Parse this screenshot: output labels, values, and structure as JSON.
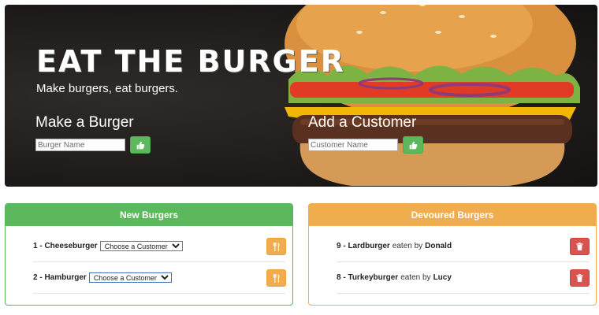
{
  "hero": {
    "title": "EAT THE BURGER",
    "tagline": "Make burgers, eat burgers.",
    "make_burger": {
      "heading": "Make a Burger",
      "placeholder": "Burger Name",
      "button_icon": "thumbs-up-icon"
    },
    "add_customer": {
      "heading": "Add a Customer",
      "placeholder": "Customer Name",
      "button_icon": "thumbs-up-icon"
    }
  },
  "new_burgers": {
    "header": "New Burgers",
    "select_default": "Choose a Customer",
    "button_icon": "utensils-icon",
    "items": [
      {
        "number": "1",
        "name": "Cheeseburger"
      },
      {
        "number": "2",
        "name": "Hamburger"
      }
    ]
  },
  "devoured_burgers": {
    "header": "Devoured Burgers",
    "connector": "eaten by",
    "button_icon": "trash-icon",
    "items": [
      {
        "number": "9",
        "name": "Lardburger",
        "customer": "Donald"
      },
      {
        "number": "8",
        "name": "Turkeyburger",
        "customer": "Lucy"
      }
    ]
  },
  "colors": {
    "success": "#5cb85c",
    "warning": "#f0ad4e",
    "danger": "#d9534f"
  }
}
